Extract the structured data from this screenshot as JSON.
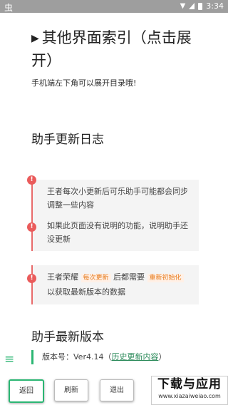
{
  "statusbar": {
    "app_icon": "虫",
    "time": "3:34"
  },
  "page": {
    "title": "其他界面索引（点击展开）",
    "title_arrow": "▶",
    "note": "手机端左下角可以展开目录哦!"
  },
  "log": {
    "heading": "助手更新日志",
    "items": [
      {
        "text": "王者每次小更新后可乐助手可能都会同步调整一些内容"
      },
      {
        "text": "如果此页面没有说明的功能，说明助手还没更新"
      },
      {
        "text_prefix": "王者荣耀",
        "tag1": "每次更新",
        "text_mid": "后都需要",
        "tag2": "重新初始化",
        "text_suffix": "以获取最新版本的数据"
      }
    ],
    "mark_glyph": "!"
  },
  "latest": {
    "heading": "助手最新版本",
    "version_label": "版本号：Ver4.14",
    "history_link": "历史更新内容",
    "paren_open": "（",
    "paren_close": "）"
  },
  "buttons": {
    "back": "返回",
    "refresh": "刷新",
    "exit": "退出"
  },
  "watermark": {
    "title": "下载与应用",
    "url": "www.xiazaiweiao.com"
  },
  "menu_icon": "≡",
  "colors": {
    "accent": "#2bb673",
    "alert": "#ea5b5b",
    "tag": "#e67e22"
  }
}
